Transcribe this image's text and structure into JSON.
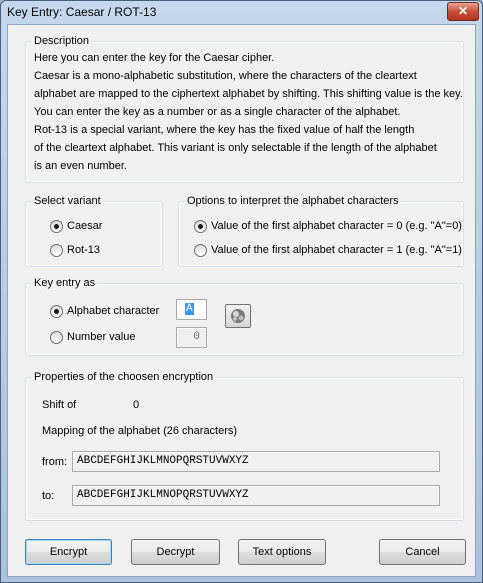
{
  "window": {
    "title": "Key Entry: Caesar / ROT-13",
    "close_symbol": "✕"
  },
  "description": {
    "legend": "Description",
    "lines": [
      "Here you can enter the key for the Caesar cipher.",
      "Caesar is a mono-alphabetic substitution, where the characters of the cleartext",
      "alphabet are mapped to the ciphertext alphabet by shifting. This shifting value is the key.",
      "You can enter the key as a number or as a single character of the alphabet.",
      "Rot-13 is a special variant, where the key has the fixed value of half the length",
      "of the cleartext alphabet. This variant is only selectable if the length of the alphabet",
      "is an even number."
    ]
  },
  "variant": {
    "legend": "Select variant",
    "caesar": "Caesar",
    "rot13": "Rot-13",
    "selected": "caesar"
  },
  "options": {
    "legend": "Options to interpret the alphabet characters",
    "first0": "Value of the first alphabet character = 0 (e.g. \"A\"=0)",
    "first1": "Value of the first alphabet character = 1 (e.g. \"A\"=1)",
    "selected": "first0"
  },
  "key_entry": {
    "legend": "Key entry as",
    "alpha_label": "Alphabet character",
    "alpha_value": "A",
    "number_label": "Number value",
    "number_value": "0",
    "selected": "alpha"
  },
  "properties": {
    "legend": "Properties of the choosen encryption",
    "shift_label": "Shift of",
    "shift_value": "0",
    "mapping_label": "Mapping of the alphabet (26 characters)",
    "from_label": "from:",
    "from_value": "ABCDEFGHIJKLMNOPQRSTUVWXYZ",
    "to_label": "to:",
    "to_value": "ABCDEFGHIJKLMNOPQRSTUVWXYZ"
  },
  "buttons": {
    "encrypt": "Encrypt",
    "decrypt": "Decrypt",
    "text_options": "Text options",
    "cancel": "Cancel"
  }
}
